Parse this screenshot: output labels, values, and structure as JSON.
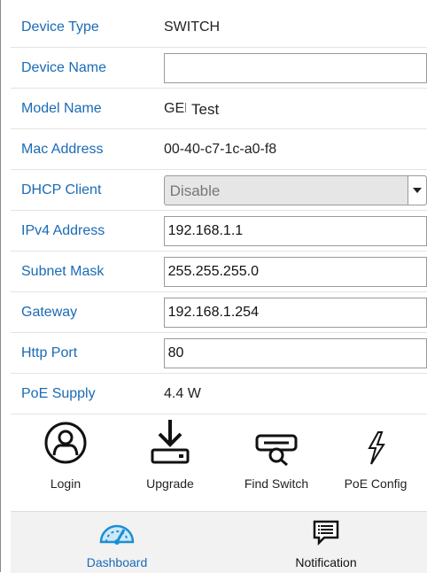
{
  "fields": [
    {
      "label": "Device Type",
      "value": "SWITCH"
    },
    {
      "label": "Device Name",
      "value": "",
      "placeholder": ""
    },
    {
      "label": "Model Name",
      "value": "GEPc",
      "tooltip": "Test"
    },
    {
      "label": "Mac Address",
      "value": "00-40-c7-1c-a0-f8"
    },
    {
      "label": "DHCP Client",
      "value": "Disable"
    },
    {
      "label": "IPv4 Address",
      "value": "192.168.1.1"
    },
    {
      "label": "Subnet Mask",
      "value": "255.255.255.0"
    },
    {
      "label": "Gateway",
      "value": "192.168.1.254"
    },
    {
      "label": "Http Port",
      "value": "80"
    },
    {
      "label": "PoE Supply",
      "value": "4.4 W"
    }
  ],
  "actions": [
    {
      "label": "Login",
      "icon": "login-user-icon"
    },
    {
      "label": "Upgrade",
      "icon": "upgrade-download-icon"
    },
    {
      "label": "Find Switch",
      "icon": "find-switch-icon"
    },
    {
      "label": "PoE Config",
      "icon": "poe-lightning-icon"
    }
  ],
  "nav": [
    {
      "label": "Dashboard",
      "icon": "dashboard-gauge-icon",
      "active": true
    },
    {
      "label": "Notification",
      "icon": "notification-message-icon",
      "active": false
    }
  ],
  "colors": {
    "label": "#1a6bb5",
    "accent": "#1a8fd6"
  }
}
